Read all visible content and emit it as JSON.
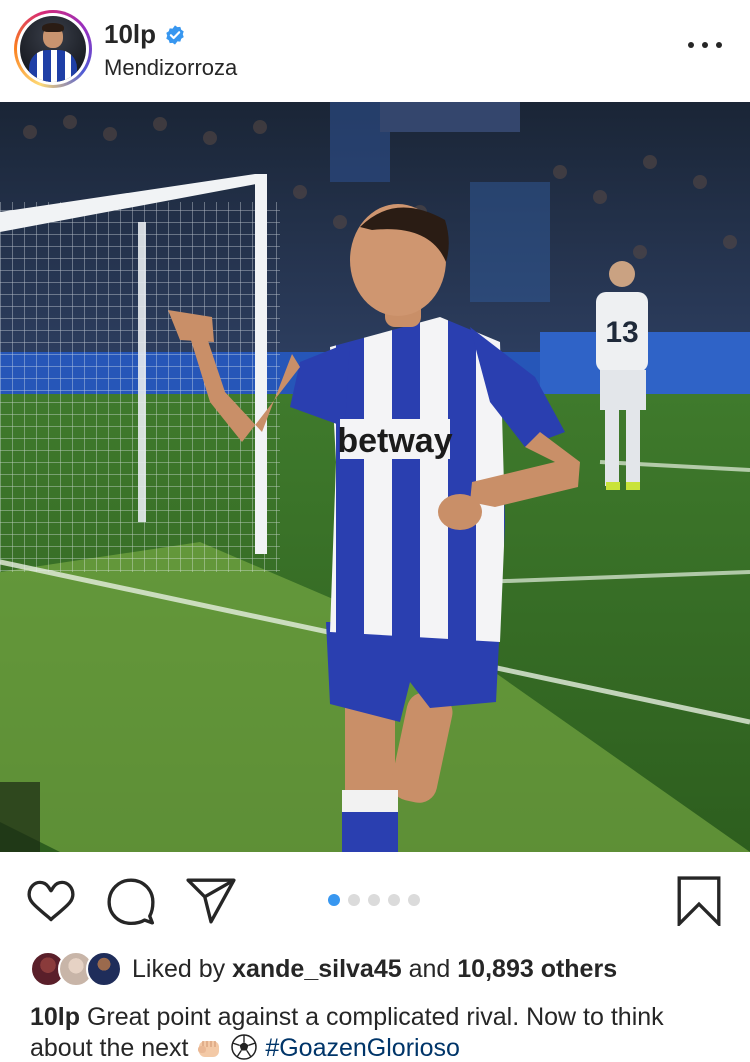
{
  "post": {
    "username": "10lp",
    "verified": true,
    "location": "Mendizorroza",
    "photo": {
      "kit_sponsor": "betway",
      "opponent_shirt_number": "13"
    },
    "carousel": {
      "count": 5,
      "active_index": 0
    },
    "likes": {
      "prefix": "Liked by",
      "first_liker": "xande_silva45",
      "joiner": "and",
      "others": "10,893 others"
    },
    "caption": {
      "user": "10lp",
      "text": "Great point against a complicated rival. Now to think about the next",
      "hashtag": "#GoazenGlorioso"
    }
  },
  "icons": {
    "header": [
      "verified-badge-icon",
      "more-options-icon"
    ],
    "actions": [
      "heart-icon",
      "comment-icon",
      "share-icon",
      "bookmark-icon"
    ]
  },
  "colors": {
    "verified": "#3897f0",
    "carousel_active": "#3897f0",
    "carousel_inactive": "#dbdbdb",
    "hashtag": "#003569",
    "text": "#262626",
    "kit_blue": "#2a3fb0"
  }
}
